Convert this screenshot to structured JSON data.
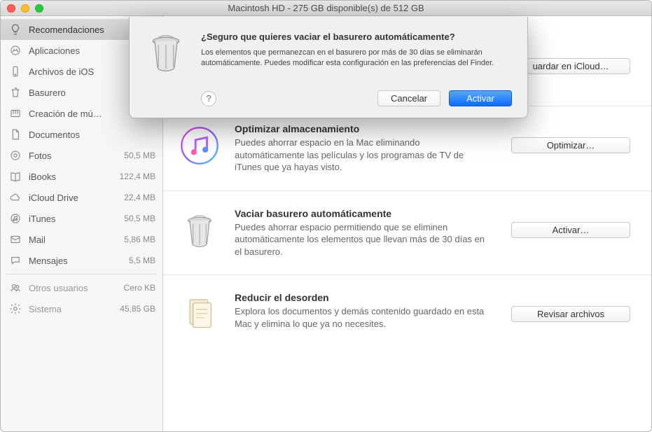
{
  "window": {
    "title": "Macintosh HD - 275 GB disponible(s) de 512 GB"
  },
  "sidebar": {
    "items": [
      {
        "label": "Recomendaciones",
        "size": "",
        "selected": true
      },
      {
        "label": "Aplicaciones",
        "size": ""
      },
      {
        "label": "Archivos de iOS",
        "size": ""
      },
      {
        "label": "Basurero",
        "size": ""
      },
      {
        "label": "Creación de mú…",
        "size": ""
      },
      {
        "label": "Documentos",
        "size": ""
      },
      {
        "label": "Fotos",
        "size": "50,5 MB"
      },
      {
        "label": "iBooks",
        "size": "122,4 MB"
      },
      {
        "label": "iCloud Drive",
        "size": "22,4 MB"
      },
      {
        "label": "iTunes",
        "size": "50,5 MB"
      },
      {
        "label": "Mail",
        "size": "5,86 MB"
      },
      {
        "label": "Mensajes",
        "size": "5,5 MB"
      }
    ],
    "items2": [
      {
        "label": "Otros usuarios",
        "size": "Cero KB"
      },
      {
        "label": "Sistema",
        "size": "45,85 GB"
      }
    ]
  },
  "recos": {
    "icloud": {
      "button": "uardar en iCloud…"
    },
    "optimize": {
      "title": "Optimizar almacenamiento",
      "desc": "Puedes ahorrar espacio en la Mac eliminando automáticamente las películas y los programas de TV de iTunes que ya hayas visto.",
      "button": "Optimizar…"
    },
    "trash": {
      "title": "Vaciar basurero automáticamente",
      "desc": "Puedes ahorrar espacio permitiendo que se eliminen automáticamente los elementos que llevan más de 30 días en el basurero.",
      "button": "Activar…"
    },
    "clutter": {
      "title": "Reducir el desorden",
      "desc": "Explora los documentos y demás contenido guardado en esta Mac y elimina lo que ya no necesites.",
      "button": "Revisar archivos"
    }
  },
  "dialog": {
    "title": "¿Seguro que quieres vaciar el basurero automáticamente?",
    "message": "Los elementos que permanezcan en el basurero por más de 30 días se eliminarán automáticamente. Puedes modificar esta configuración en las preferencias del Finder.",
    "help": "?",
    "cancel": "Cancelar",
    "confirm": "Activar"
  }
}
